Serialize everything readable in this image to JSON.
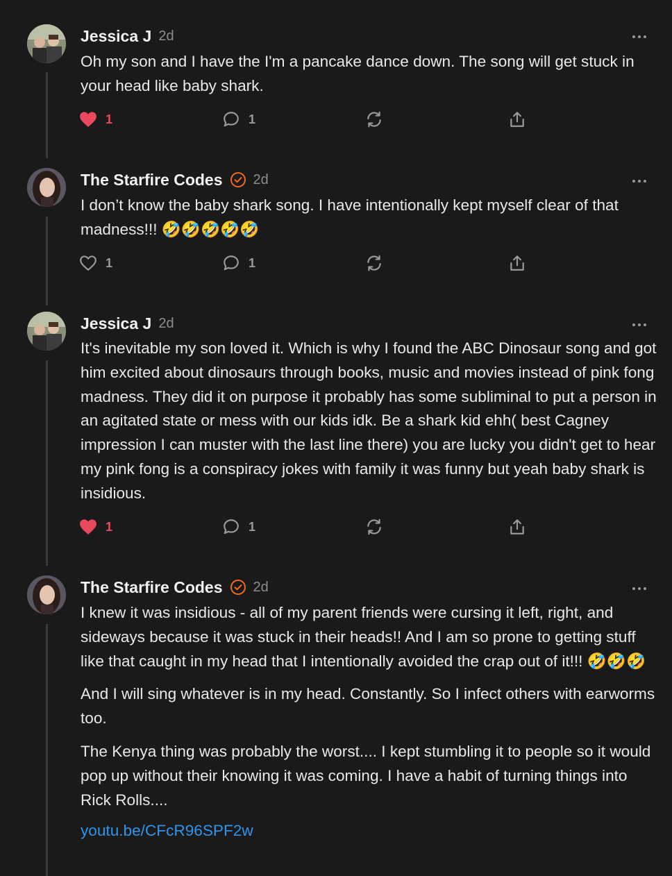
{
  "colors": {
    "background": "#1a1a1a",
    "like": "#e9495d",
    "link": "#2d95ea",
    "verified": "#f26b1d"
  },
  "comments": [
    {
      "author": "Jessica J",
      "time": "2d",
      "verified": false,
      "paragraphs": [
        "Oh my son and I have the I'm a pancake dance down. The song will get stuck in your head like baby shark."
      ],
      "likes": "1",
      "liked": true,
      "replies": "1"
    },
    {
      "author": "The Starfire Codes",
      "time": "2d",
      "verified": true,
      "paragraphs": [
        "I don’t know the baby shark song. I have intentionally kept myself clear of that madness!!! 🤣🤣🤣🤣🤣"
      ],
      "likes": "1",
      "liked": false,
      "replies": "1"
    },
    {
      "author": "Jessica J",
      "time": "2d",
      "verified": false,
      "paragraphs": [
        "It's inevitable my son loved it. Which is why I found the ABC Dinosaur song and got him excited about dinosaurs through books, music and movies instead of pink fong madness. They did it on purpose it probably has some subliminal to put a person in an agitated state or mess with our kids idk. Be a shark kid ehh( best Cagney impression I can muster with the last line there) you are lucky you didn't get to hear my pink fong is a conspiracy jokes with family it was funny but yeah baby shark is insidious."
      ],
      "likes": "1",
      "liked": true,
      "replies": "1"
    },
    {
      "author": "The Starfire Codes",
      "time": "2d",
      "verified": true,
      "paragraphs": [
        "I knew it was insidious - all of my parent friends were cursing it left, right, and sideways because it was stuck in their heads!! And I am so prone to getting stuff like that caught in my head that I intentionally avoided the crap out of it!!! 🤣🤣🤣",
        "And I will sing whatever is in my head. Constantly. So I infect others with earworms too.",
        "The Kenya thing was probably the worst.... I kept stumbling it to people so it would pop up without their knowing it was coming. I have a habit of turning things into Rick Rolls...."
      ],
      "link": "youtu.be/CFcR96SPF2w"
    }
  ],
  "icons": {
    "like": "heart-icon",
    "reply": "speech-bubble-icon",
    "restack": "restack-arrows-icon",
    "share": "share-upload-icon",
    "more": "ellipsis-icon",
    "verified": "verified-check-icon"
  }
}
